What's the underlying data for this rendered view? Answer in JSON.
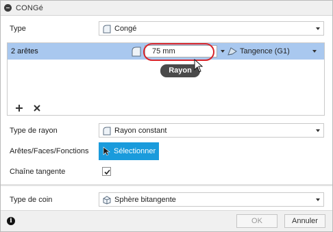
{
  "dialog": {
    "title": "CONGé"
  },
  "type_row": {
    "label": "Type",
    "value": "Congé",
    "icon": "fillet-icon"
  },
  "edges_list": {
    "row_label": "2 arêtes",
    "radius_value": "75 mm",
    "tangency_value": "Tangence (G1)",
    "tooltip": "Rayon",
    "add_icon": "plus-icon",
    "remove_icon": "x-icon",
    "highlight_color": "#d9242a",
    "selected_row_color": "#a9c8ef"
  },
  "radius_type_row": {
    "label": "Type de rayon",
    "value": "Rayon constant"
  },
  "selection_row": {
    "label": "Arêtes/Faces/Fonctions",
    "button_label": "Sélectionner",
    "button_color": "#1a9bdc"
  },
  "tangent_chain_row": {
    "label": "Chaîne tangente",
    "checked": true
  },
  "corner_type_row": {
    "label": "Type de coin",
    "value": "Sphère bitangente"
  },
  "footer": {
    "info_glyph": "i",
    "ok_label": "OK",
    "cancel_label": "Annuler"
  }
}
